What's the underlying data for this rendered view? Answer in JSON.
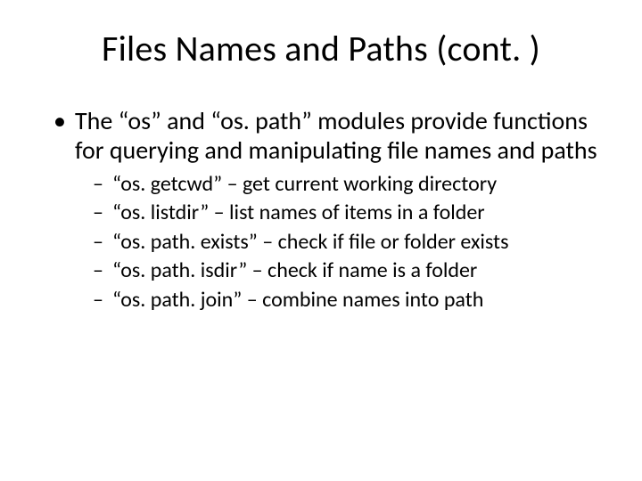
{
  "slide": {
    "title": "Files Names and Paths (cont. )",
    "bullets": [
      {
        "text": "The “os” and “os. path” modules provide functions for querying and manipulating file names and paths",
        "sub": [
          "“os. getcwd” – get current working directory",
          "“os. listdir” – list names of items in a folder",
          "“os. path. exists” – check if file or folder exists",
          "“os. path. isdir” – check if name is a folder",
          "“os. path. join” – combine names into path"
        ]
      }
    ]
  }
}
